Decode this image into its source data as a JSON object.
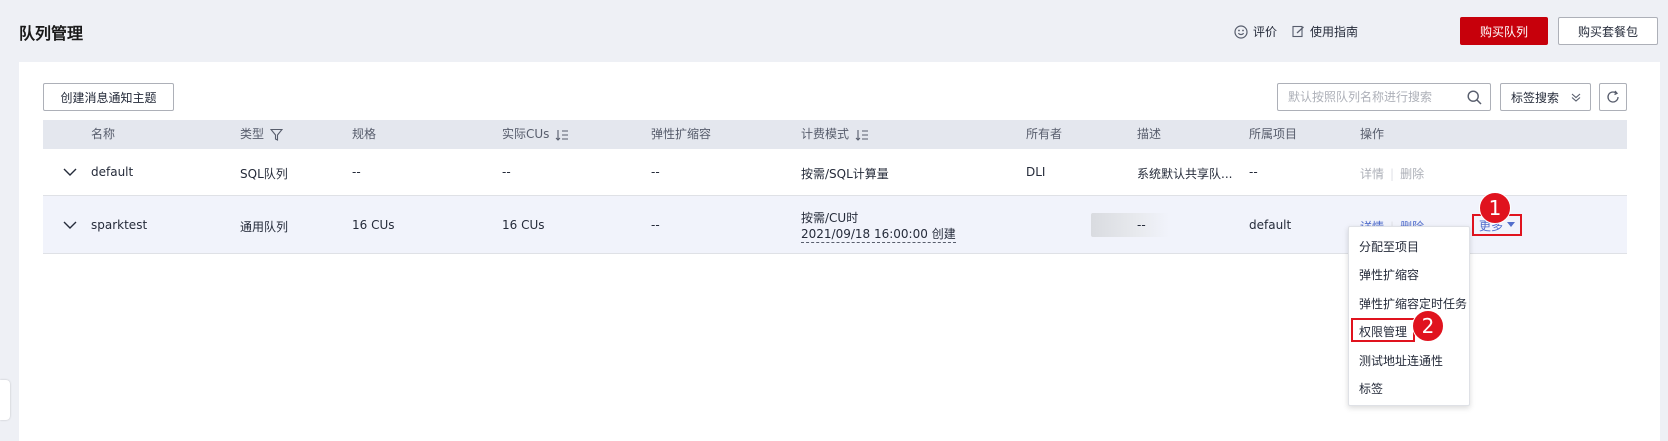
{
  "header": {
    "title": "队列管理",
    "rate_label": "评价",
    "guide_label": "使用指南",
    "buy_queue": "购买队列",
    "buy_package": "购买套餐包"
  },
  "toolbar": {
    "create_topic": "创建消息通知主题",
    "search_placeholder": "默认按照队列名称进行搜索",
    "tag_search": "标签搜索"
  },
  "columns": [
    "名称",
    "类型",
    "规格",
    "实际CUs",
    "弹性扩缩容",
    "计费模式",
    "所有者",
    "描述",
    "所属项目",
    "操作"
  ],
  "rows": [
    {
      "name": "default",
      "type": "SQL队列",
      "spec": "--",
      "actual_cus": "--",
      "elastic": "--",
      "billing": "按需/SQL计算量",
      "owner": "DLI",
      "desc": "系统默认共享队...",
      "project": "--",
      "op_detail": "详情",
      "op_delete": "删除"
    },
    {
      "name": "sparktest",
      "type": "通用队列",
      "spec": "16 CUs",
      "actual_cus": "16 CUs",
      "elastic": "--",
      "billing": "按需/CU时",
      "billing_time": "2021/09/18 16:00:00 创建",
      "owner": "",
      "desc": "--",
      "project": "default",
      "op_detail": "详情",
      "op_delete": "删除",
      "op_more": "更多"
    }
  ],
  "more_menu": [
    "分配至项目",
    "弹性扩缩容",
    "弹性扩缩容定时任务",
    "权限管理",
    "测试地址连通性",
    "标签"
  ],
  "badges": [
    "1",
    "2"
  ],
  "colors": {
    "primary": "#c7000b",
    "link": "#526ecc",
    "highlight": "#e0131e"
  }
}
